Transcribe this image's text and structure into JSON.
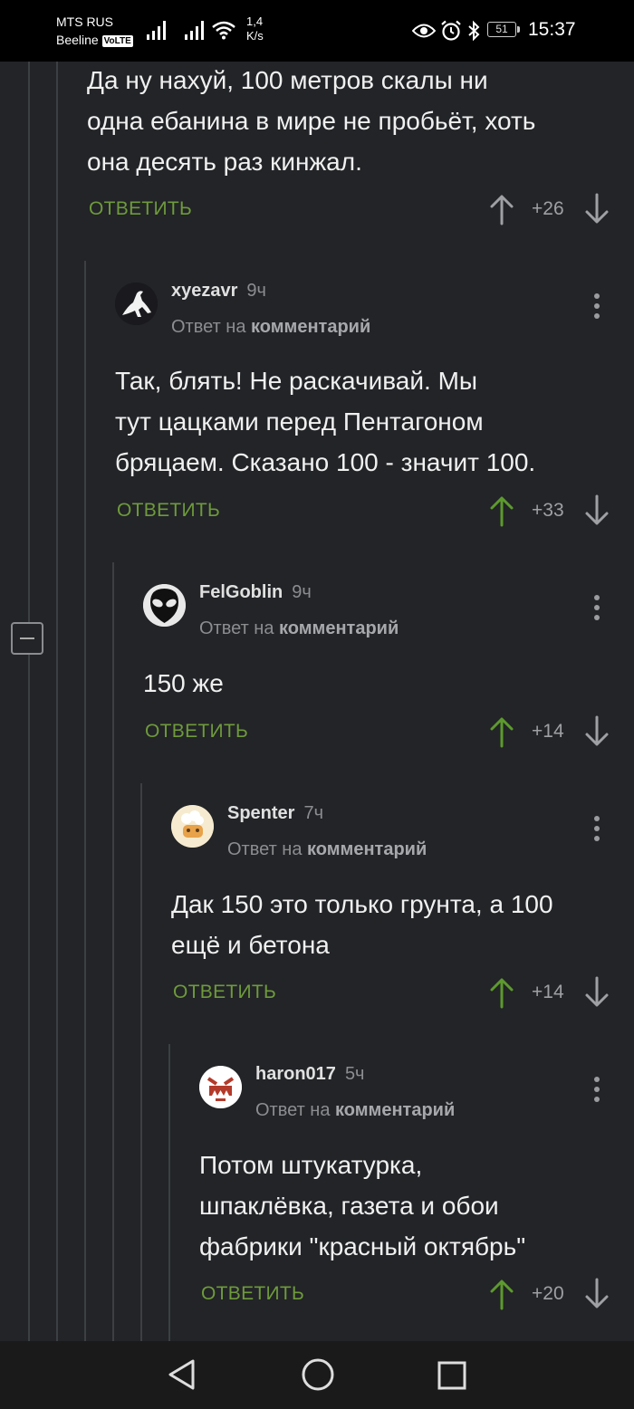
{
  "status_bar": {
    "carrier1": "MTS RUS",
    "carrier2": "Beeline",
    "volte": "VoLTE",
    "net_speed_value": "1,4",
    "net_speed_unit": "K/s",
    "battery": "51",
    "time": "15:37",
    "icons": [
      "signal-icon",
      "signal-icon",
      "wifi-icon",
      "eye-icon",
      "alarm-icon",
      "bluetooth-icon",
      "battery-icon"
    ]
  },
  "labels": {
    "reply": "ОТВЕТИТЬ",
    "reply_prefix": "Ответ на",
    "reply_target": "комментарий"
  },
  "comments": [
    {
      "author": "",
      "time": "",
      "text_lines": [
        "Да ну нахуй, 100 метров скалы ни",
        "одна ебанина в мире не пробьёт, хоть",
        "она десять раз кинжал."
      ],
      "score": "+26",
      "vote": "none"
    },
    {
      "author": "xyezavr",
      "time": "9ч",
      "text_lines": [
        "Так, блять! Не раскачивай. Мы",
        "тут цацками перед Пентагоном",
        "бряцаем. Сказано 100 - значит 100."
      ],
      "score": "+33",
      "vote": "up",
      "avatar": "dinosaur-avatar"
    },
    {
      "author": "FelGoblin",
      "time": "9ч",
      "text_lines": [
        "150 же"
      ],
      "score": "+14",
      "vote": "up",
      "avatar": "alien-avatar"
    },
    {
      "author": "Spenter",
      "time": "7ч",
      "text_lines": [
        "Дак 150 это только грунта, а 100",
        "ещё и бетона"
      ],
      "score": "+14",
      "vote": "up",
      "avatar": "cartoon-avatar"
    },
    {
      "author": "haron017",
      "time": "5ч",
      "text_lines": [
        "Потом штукатурка,",
        "шпаклёвка, газета и обои",
        "фабрики \"красный октябрь\""
      ],
      "score": "+20",
      "vote": "up",
      "avatar": "robot-avatar"
    }
  ],
  "colors": {
    "background": "#222427",
    "reply_green": "#6f9a3c",
    "upvote_green": "#5d9a2e",
    "muted": "#8b8d90"
  },
  "nav": [
    "back-icon",
    "home-icon",
    "recent-apps-icon"
  ]
}
